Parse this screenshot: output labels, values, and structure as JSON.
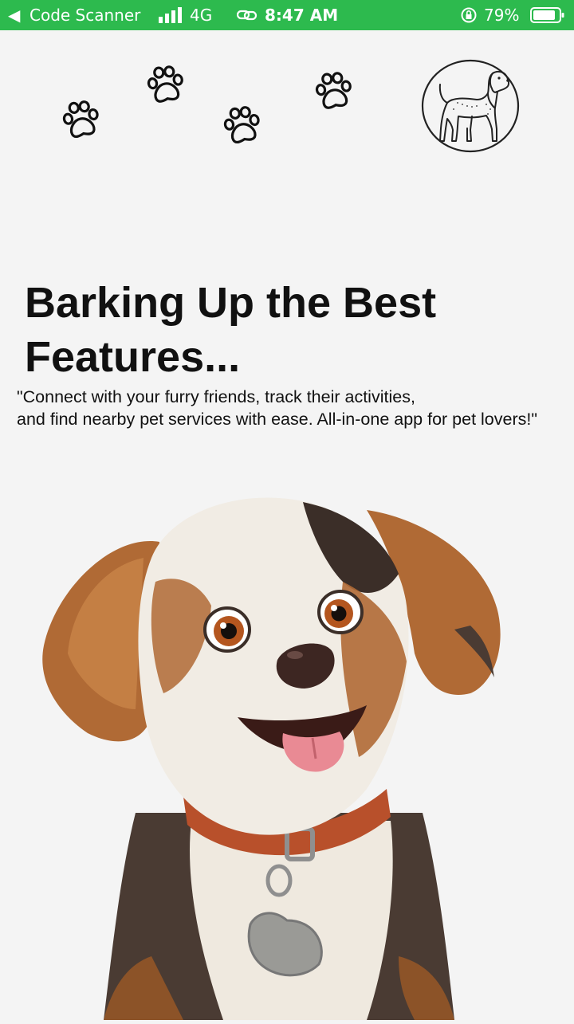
{
  "status_bar": {
    "back_glyph": "◀",
    "app_name": "Code Scanner",
    "network": "4G",
    "time": "8:47 AM",
    "battery": "79%",
    "icons": [
      "back-arrow-icon",
      "signal-icon",
      "link-icon",
      "rotation-lock-icon",
      "battery-icon"
    ],
    "bar_color": "#2dba4e"
  },
  "decor": {
    "icons": [
      "paw-print-icon",
      "dog-badge-icon",
      "puppy-illustration"
    ]
  },
  "onboarding": {
    "headline": "Barking Up the Best Features...",
    "tagline": "\"Connect with your furry friends, track their activities,\n and find nearby pet services with ease. All-in-one app for pet lovers!\""
  }
}
